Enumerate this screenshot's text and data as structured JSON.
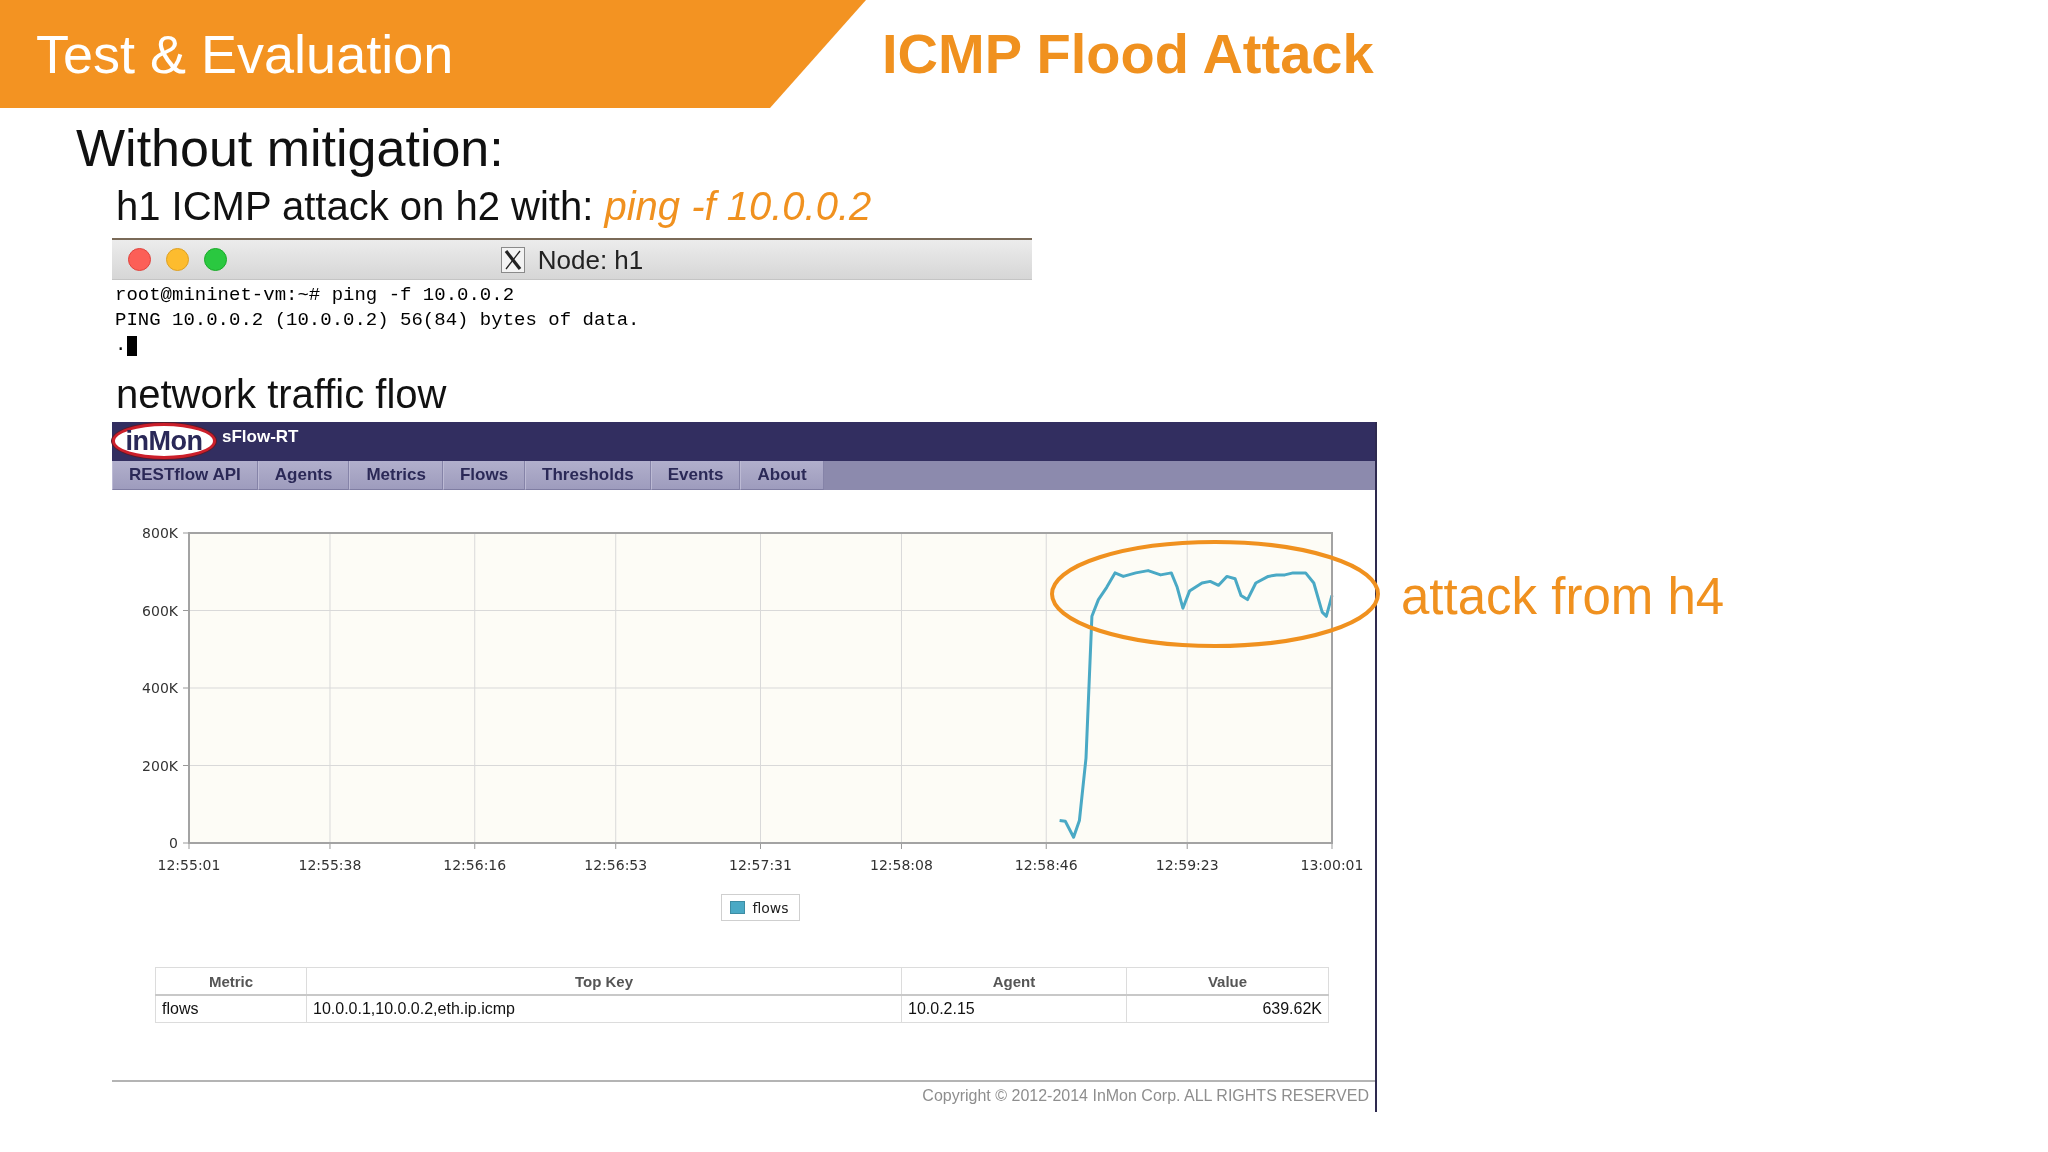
{
  "slide": {
    "section": "Test & Evaluation",
    "title": "ICMP Flood Attack"
  },
  "heading": "Without mitigation:",
  "subheading": "h1 ICMP attack on h2 with: *ping -f 10.0.0.2*",
  "terminal": {
    "title": "Node: h1",
    "lines": [
      "root@mininet-vm:~# ping -f 10.0.0.2",
      "PING 10.0.0.2 (10.0.0.2) 56(84) bytes of data.",
      "."
    ]
  },
  "section_label": "network traffic flow",
  "sflow": {
    "logo": "inMon",
    "app_name": "sFlow-RT",
    "nav": [
      {
        "label": "RESTflow API",
        "selected": false
      },
      {
        "label": "Agents",
        "selected": false
      },
      {
        "label": "Metrics",
        "selected": false
      },
      {
        "label": "Flows",
        "selected": false
      },
      {
        "label": "Thresholds",
        "selected": false
      },
      {
        "label": "Events",
        "selected": false
      },
      {
        "label": "About",
        "selected": false
      }
    ],
    "chart_data": [
      {
        "type": "line",
        "grid": true,
        "legend": "bottom",
        "xlim": [
          12.916944,
          13.000278
        ],
        "ylim": [
          0,
          800000
        ],
        "xticks": [
          {
            "value": 12.916944,
            "label": "12:55:01"
          },
          {
            "value": 12.927222,
            "label": "12:55:38"
          },
          {
            "value": 12.937778,
            "label": "12:56:16"
          },
          {
            "value": 12.948056,
            "label": "12:56:53"
          },
          {
            "value": 12.958611,
            "label": "12:57:31"
          },
          {
            "value": 12.968889,
            "label": "12:58:08"
          },
          {
            "value": 12.979444,
            "label": "12:58:46"
          },
          {
            "value": 12.989722,
            "label": "12:59:23"
          },
          {
            "value": 13.000278,
            "label": "13:00:01"
          }
        ],
        "yticks": [
          {
            "value": 0,
            "label": "0"
          },
          {
            "value": 200000,
            "label": "200K"
          },
          {
            "value": 400000,
            "label": "400K"
          },
          {
            "value": 600000,
            "label": "600K"
          },
          {
            "value": 800000,
            "label": "800K"
          }
        ],
        "x": [
          12.98042,
          12.98083,
          12.98144,
          12.98186,
          12.98234,
          12.98277,
          12.98325,
          12.98385,
          12.98446,
          12.98506,
          12.98597,
          12.98687,
          12.98778,
          12.98856,
          12.98899,
          12.98941,
          12.98989,
          12.9908,
          12.9914,
          12.99201,
          12.99261,
          12.99321,
          12.99364,
          12.99412,
          12.99472,
          12.99563,
          12.99623,
          12.99684,
          12.99744,
          12.99835,
          12.99895,
          12.99956,
          12.99986,
          13.000278
        ],
        "series": [
          {
            "name": "flows",
            "color": "#4aa9c5",
            "values": [
              58000,
              56000,
              15000,
              58000,
              219000,
              585000,
              628000,
              660000,
              697000,
              688000,
              697000,
              703000,
              692000,
              697000,
              660000,
              606000,
              650000,
              671000,
              675000,
              665000,
              688000,
              682000,
              639000,
              628000,
              671000,
              688000,
              692000,
              692000,
              697000,
              697000,
              671000,
              596000,
              585000,
              639000
            ]
          }
        ]
      }
    ],
    "table": {
      "columns": [
        "Metric",
        "Top Key",
        "Agent",
        "Value"
      ],
      "rows": [
        [
          "flows",
          "10.0.0.1,10.0.0.2,eth.ip.icmp",
          "10.0.2.15",
          "639.62K"
        ]
      ]
    },
    "copyright": "Copyright © 2012-2014 InMon Corp. ALL RIGHTS RESERVED"
  },
  "callout": "attack from h4"
}
